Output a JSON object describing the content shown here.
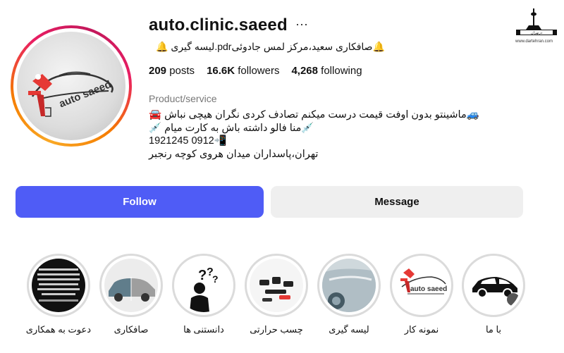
{
  "profile": {
    "username": "auto.clinic.saeed",
    "bio_line1": "🔔صافکاری سعید،مرکز لمس جادوئیpdr.لیسه گیری 🔔",
    "category": "Product/service",
    "bio_lines": [
      "🚙ماشینتو بدون اوفت قیمت درست میکنم تصادف کردی نگران هیچی نباش 🚘",
      "💉منا فالو داشته باش به کارت میام 💉",
      "1921245 0912📲",
      "تهران،پاسداران میدان هروی کوچه رنجبر"
    ],
    "avatar_brand_text": "auto saeed"
  },
  "stats": {
    "posts_count": "209",
    "posts_label": "posts",
    "followers_count": "16.6K",
    "followers_label": "followers",
    "following_count": "4,268",
    "following_label": "following"
  },
  "actions": {
    "follow_label": "Follow",
    "message_label": "Message",
    "more_label": "···"
  },
  "highlights": [
    {
      "label": "دعوت به همکاری"
    },
    {
      "label": "صافکاری"
    },
    {
      "label": "دانستنی ها"
    },
    {
      "label": "چسب حرارتی"
    },
    {
      "label": "لیسه گیری"
    },
    {
      "label": "نمونه کار"
    },
    {
      "label": "با ما"
    }
  ],
  "watermark": {
    "logo_text": "درتهران",
    "url": "www.dartehran.com"
  },
  "colors": {
    "follow_button": "#4f5cf6",
    "message_button": "#efefef",
    "brand_red": "#e53935"
  }
}
